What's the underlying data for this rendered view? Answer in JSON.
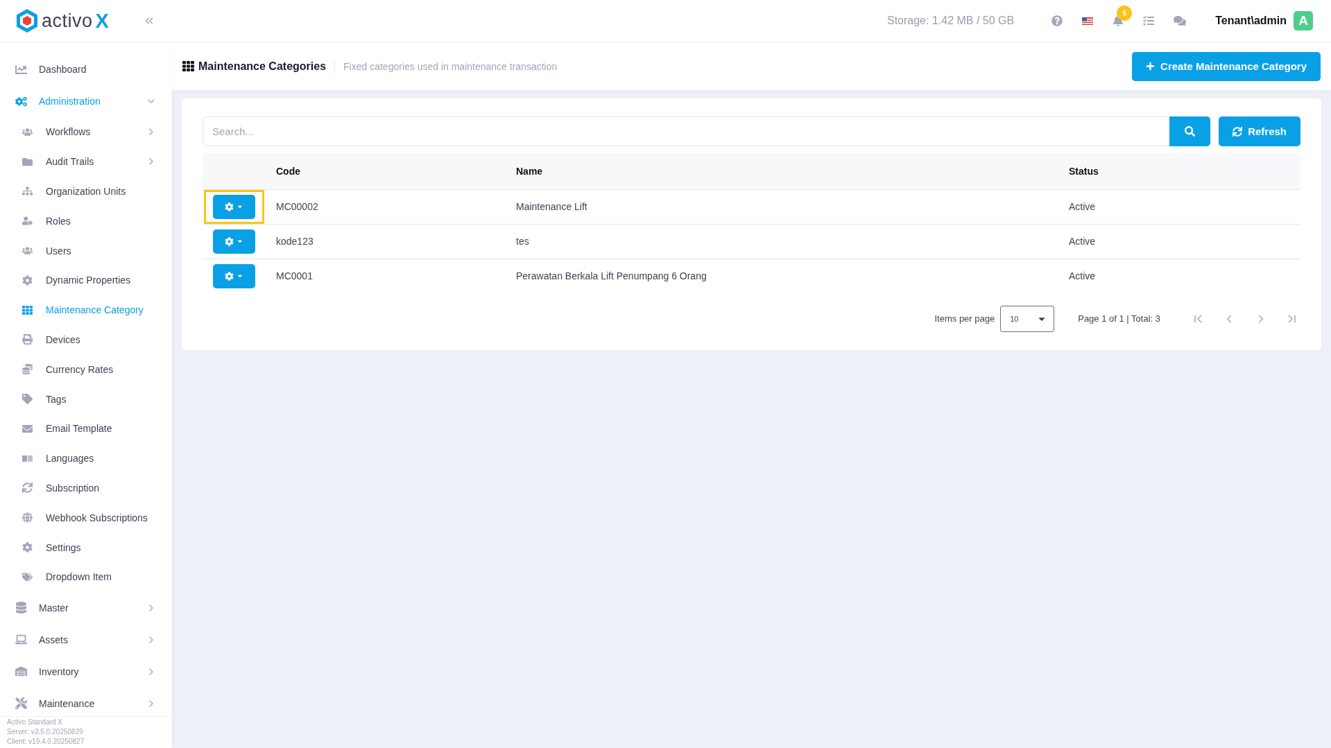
{
  "brand": {
    "name": "activo",
    "mark": "X"
  },
  "topbar": {
    "storage": "Storage: 1.42 MB / 50 GB",
    "notifications": "5",
    "user": "Tenant\\admin",
    "avatar": "A"
  },
  "sidebar": {
    "items": [
      {
        "label": "Dashboard",
        "selected": false
      },
      {
        "label": "Administration",
        "selected": true,
        "expanded": true,
        "children": [
          {
            "label": "Workflows",
            "selected": false,
            "expanded": false
          },
          {
            "label": "Audit Trails",
            "selected": false,
            "expanded": false
          },
          {
            "label": "Organization Units",
            "selected": false
          },
          {
            "label": "Roles",
            "selected": false
          },
          {
            "label": "Users",
            "selected": false
          },
          {
            "label": "Dynamic Properties",
            "selected": false
          },
          {
            "label": "Maintenance Category",
            "selected": true
          },
          {
            "label": "Devices",
            "selected": false
          },
          {
            "label": "Currency Rates",
            "selected": false
          },
          {
            "label": "Tags",
            "selected": false
          },
          {
            "label": "Email Template",
            "selected": false
          },
          {
            "label": "Languages",
            "selected": false
          },
          {
            "label": "Subscription",
            "selected": false
          },
          {
            "label": "Webhook Subscriptions",
            "selected": false
          },
          {
            "label": "Settings",
            "selected": false
          },
          {
            "label": "Dropdown Item",
            "selected": false
          }
        ]
      },
      {
        "label": "Master",
        "selected": false,
        "expanded": false
      },
      {
        "label": "Assets",
        "selected": false,
        "expanded": false
      },
      {
        "label": "Inventory",
        "selected": false,
        "expanded": false
      },
      {
        "label": "Maintenance",
        "selected": false,
        "expanded": false
      }
    ],
    "footer": [
      "Activo Standard X",
      "Server: v3.5.0.20250829",
      "Client: v19.4.0.20250827"
    ]
  },
  "page": {
    "title": "Maintenance Categories",
    "subtitle": "Fixed categories used in maintenance transaction",
    "create_button": "Create Maintenance Category"
  },
  "search": {
    "placeholder": "Search..."
  },
  "refresh_button": "Refresh",
  "table": {
    "columns": [
      "Code",
      "Name",
      "Status"
    ],
    "rows": [
      {
        "code": "MC00002",
        "name": "Maintenance Lift",
        "status": "Active",
        "highlighted": true
      },
      {
        "code": "kode123",
        "name": "tes",
        "status": "Active",
        "highlighted": false
      },
      {
        "code": "MC0001",
        "name": "Perawatan Berkala Lift Penumpang 6 Orang",
        "status": "Active",
        "highlighted": false
      }
    ]
  },
  "pagination": {
    "items_per_page_label": "Items per page",
    "page_size": "10",
    "summary": "Page 1 of 1 | Total: 3"
  }
}
